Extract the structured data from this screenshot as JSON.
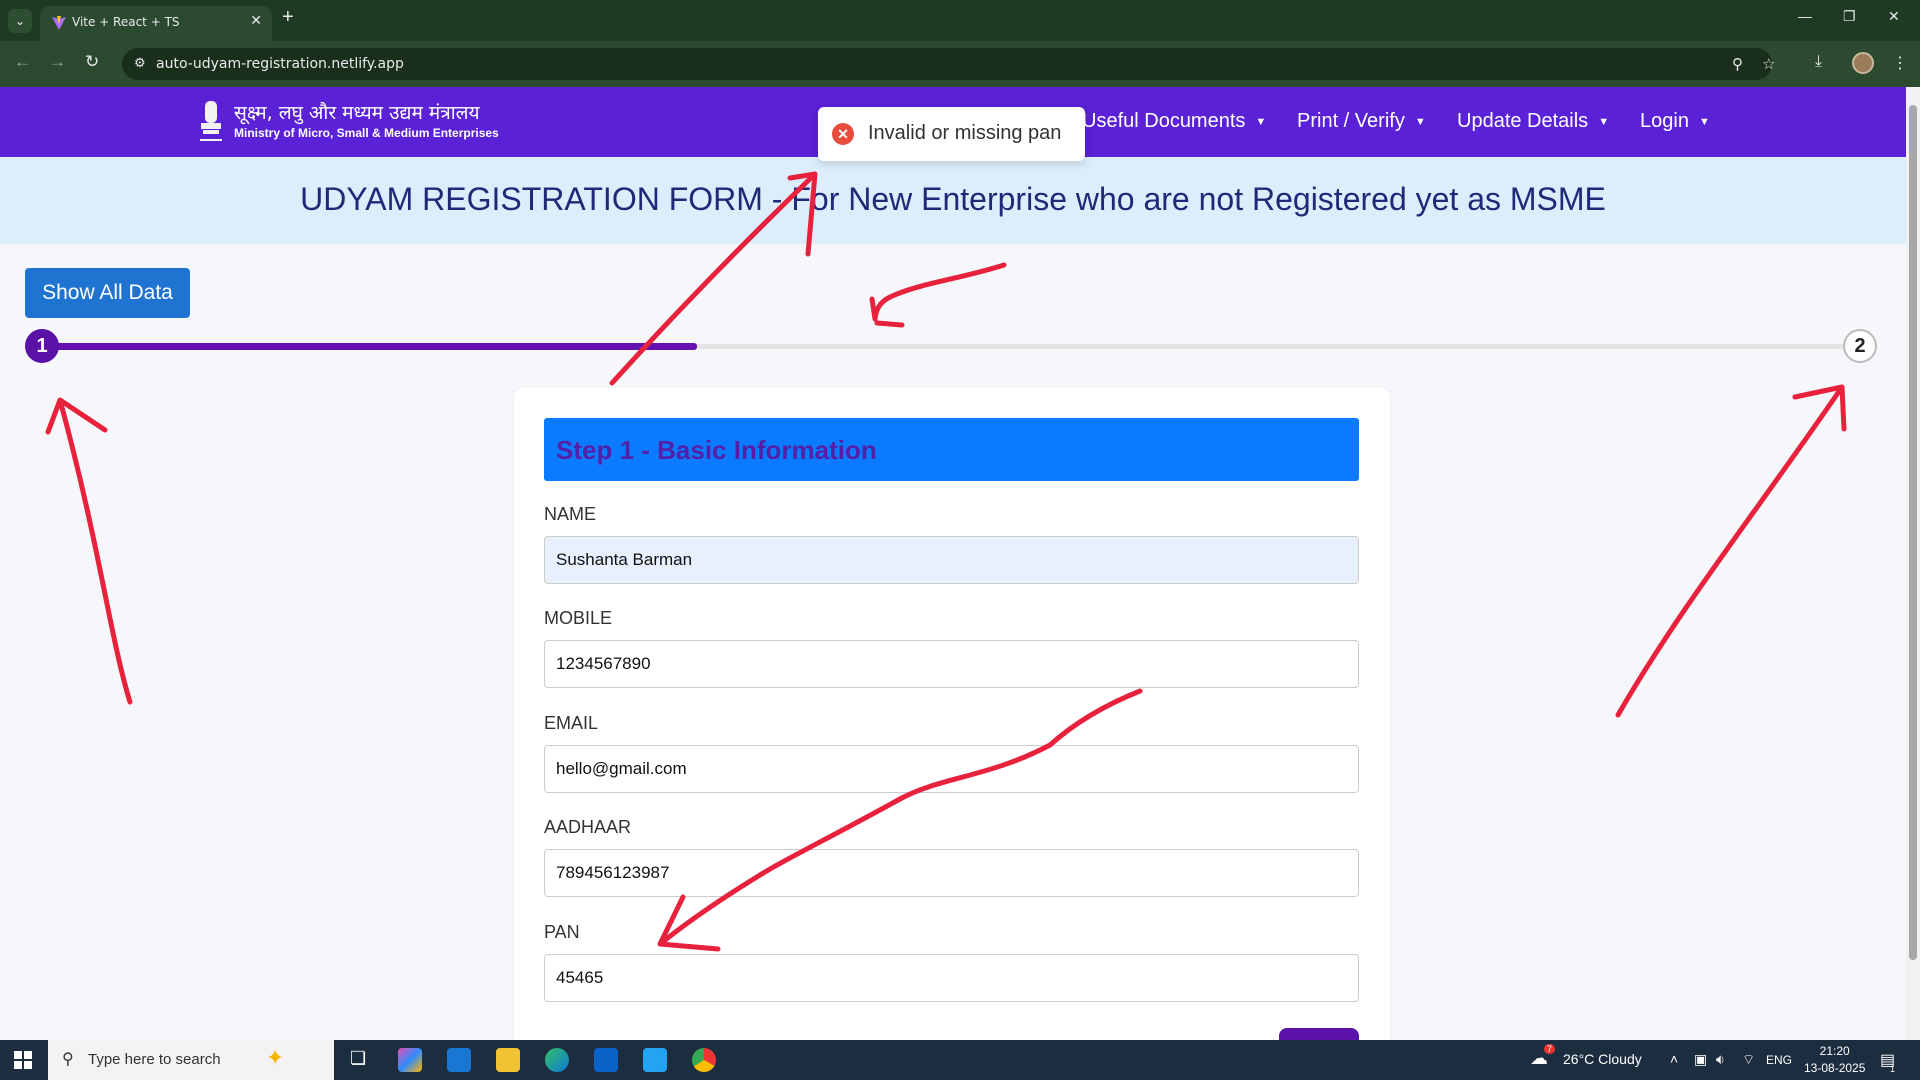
{
  "browser": {
    "tab_title": "Vite + React + TS",
    "url": "auto-udyam-registration.netlify.app"
  },
  "header": {
    "logo_hindi": "सूक्ष्म, लघु और मध्यम उद्यम मंत्रालय",
    "logo_english": "Ministry of Micro, Small & Medium Enterprises",
    "menu": [
      {
        "label": "Useful Documents"
      },
      {
        "label": "Print / Verify"
      },
      {
        "label": "Update Details"
      },
      {
        "label": "Login"
      }
    ]
  },
  "toast": {
    "message": "Invalid or missing pan"
  },
  "banner": {
    "title": "UDYAM REGISTRATION FORM - For New Enterprise who are not Registered yet as MSME"
  },
  "actions": {
    "show_all": "Show All Data"
  },
  "stepper": {
    "steps": [
      "1",
      "2"
    ],
    "current_step": 1,
    "progress_fraction": 0.36
  },
  "form": {
    "section_title": "Step 1 - Basic Information",
    "fields": [
      {
        "label": "NAME",
        "value": "Sushanta Barman"
      },
      {
        "label": "MOBILE",
        "value": "1234567890"
      },
      {
        "label": "EMAIL",
        "value": "hello@gmail.com"
      },
      {
        "label": "AADHAAR",
        "value": "789456123987"
      },
      {
        "label": "PAN",
        "value": "45465"
      }
    ]
  },
  "taskbar": {
    "search_placeholder": "Type here to search",
    "weather": "26°C  Cloudy",
    "weather_badge": "7",
    "language": "ENG",
    "time": "21:20",
    "date": "13-08-2025",
    "notifications": "1"
  },
  "colors": {
    "header_bg": "#5b21d6",
    "annotation_red": "#e8213c",
    "step_active": "#5a12a6",
    "section_head": "#0a7bff"
  }
}
